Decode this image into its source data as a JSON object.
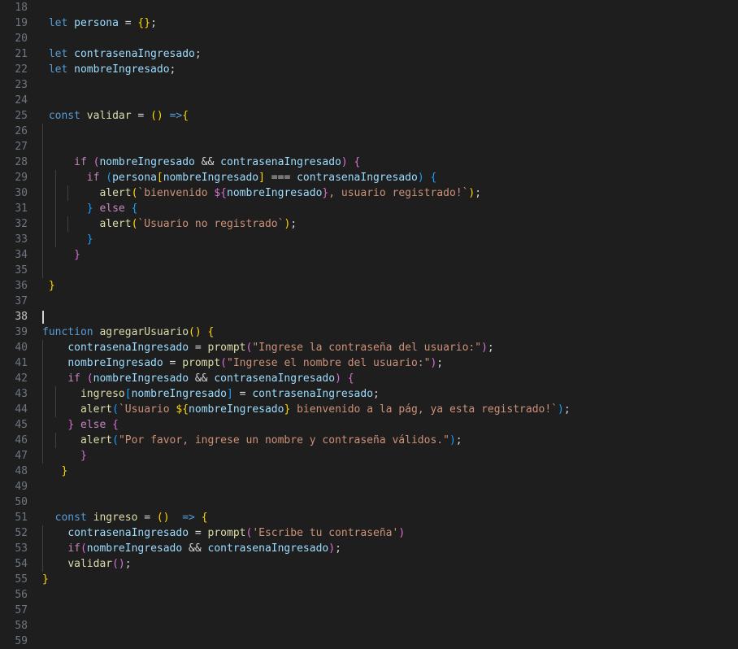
{
  "editor": {
    "language": "javascript",
    "first_line_number": 18,
    "active_line_number": 38,
    "cursor_line": 38,
    "cursor_column": 1,
    "colors": {
      "background": "#1e1e1e",
      "active_line_background": "#222222",
      "line_number": "#6e7681",
      "active_line_number": "#c6c6c6",
      "default_text": "#d4d4d4",
      "keyword": "#569cd6",
      "control_keyword": "#c586c0",
      "variable": "#9cdcfe",
      "function": "#dcdcaa",
      "string": "#ce9178",
      "bracket_level_1": "#ffd700",
      "bracket_level_2": "#da70d6",
      "bracket_level_3": "#179fff",
      "indent_guide": "#404040",
      "cursor": "#d4d4d4"
    },
    "lines": [
      {
        "n": 18,
        "text": ""
      },
      {
        "n": 19,
        "text": "let persona = {};"
      },
      {
        "n": 20,
        "text": ""
      },
      {
        "n": 21,
        "text": "let contrasenaIngresado;"
      },
      {
        "n": 22,
        "text": "let nombreIngresado;"
      },
      {
        "n": 23,
        "text": ""
      },
      {
        "n": 24,
        "text": ""
      },
      {
        "n": 25,
        "text": "const validar = () =>{"
      },
      {
        "n": 26,
        "text": ""
      },
      {
        "n": 27,
        "text": ""
      },
      {
        "n": 28,
        "text": "    if (nombreIngresado && contrasenaIngresado) {"
      },
      {
        "n": 29,
        "text": "      if (persona[nombreIngresado] === contrasenaIngresado) {"
      },
      {
        "n": 30,
        "text": "        alert(`bienvenido ${nombreIngresado}, usuario registrado!`);"
      },
      {
        "n": 31,
        "text": "      } else {"
      },
      {
        "n": 32,
        "text": "        alert(`Usuario no registrado`);"
      },
      {
        "n": 33,
        "text": "      }"
      },
      {
        "n": 34,
        "text": "    }"
      },
      {
        "n": 35,
        "text": ""
      },
      {
        "n": 36,
        "text": " }"
      },
      {
        "n": 37,
        "text": ""
      },
      {
        "n": 38,
        "text": ""
      },
      {
        "n": 39,
        "text": "function agregarUsuario() {"
      },
      {
        "n": 40,
        "text": "    contrasenaIngresado = prompt(\"Ingrese la contraseña del usuario:\");"
      },
      {
        "n": 41,
        "text": "    nombreIngresado = prompt(\"Ingrese el nombre del usuario:\");"
      },
      {
        "n": 42,
        "text": "    if (nombreIngresado && contrasenaIngresado) {"
      },
      {
        "n": 43,
        "text": "      ingreso[nombreIngresado] = contrasenaIngresado;"
      },
      {
        "n": 44,
        "text": "      alert(`Usuario ${nombreIngresado} bienvenido a la pág, ya esta registrado!`);"
      },
      {
        "n": 45,
        "text": "    } else {"
      },
      {
        "n": 46,
        "text": "      alert(\"Por favor, ingrese un nombre y contraseña válidos.\");"
      },
      {
        "n": 47,
        "text": "      }"
      },
      {
        "n": 48,
        "text": "   }"
      },
      {
        "n": 49,
        "text": ""
      },
      {
        "n": 50,
        "text": ""
      },
      {
        "n": 51,
        "text": "  const ingreso = ()  => {"
      },
      {
        "n": 52,
        "text": "    contrasenaIngresado = prompt('Escribe tu contraseña')"
      },
      {
        "n": 53,
        "text": "    if(nombreIngresado && contrasenaIngresado);"
      },
      {
        "n": 54,
        "text": "    validar();"
      },
      {
        "n": 55,
        "text": "}"
      },
      {
        "n": 56,
        "text": ""
      },
      {
        "n": 57,
        "text": ""
      },
      {
        "n": 58,
        "text": ""
      },
      {
        "n": 59,
        "text": ""
      }
    ],
    "tokens": {
      "19": [
        [
          " ",
          "op"
        ],
        [
          "let",
          "kw"
        ],
        [
          " ",
          "op"
        ],
        [
          "persona",
          "var"
        ],
        [
          " = ",
          "op"
        ],
        [
          "{}",
          "by"
        ],
        [
          ";",
          "op"
        ]
      ],
      "21": [
        [
          " ",
          "op"
        ],
        [
          "let",
          "kw"
        ],
        [
          " ",
          "op"
        ],
        [
          "contrasenaIngresado",
          "var"
        ],
        [
          ";",
          "op"
        ]
      ],
      "22": [
        [
          " ",
          "op"
        ],
        [
          "let",
          "kw"
        ],
        [
          " ",
          "op"
        ],
        [
          "nombreIngresado",
          "var"
        ],
        [
          ";",
          "op"
        ]
      ],
      "25": [
        [
          " ",
          "op"
        ],
        [
          "const",
          "kw"
        ],
        [
          " ",
          "op"
        ],
        [
          "validar",
          "fn"
        ],
        [
          " = ",
          "op"
        ],
        [
          "()",
          "by"
        ],
        [
          " ",
          "op"
        ],
        [
          "=>",
          "kw"
        ],
        [
          "{",
          "by"
        ]
      ],
      "28": [
        [
          "     ",
          "op"
        ],
        [
          "if",
          "ctrl"
        ],
        [
          " ",
          "op"
        ],
        [
          "(",
          "bp"
        ],
        [
          "nombreIngresado",
          "var"
        ],
        [
          " && ",
          "op"
        ],
        [
          "contrasenaIngresado",
          "var"
        ],
        [
          ")",
          "bp"
        ],
        [
          " ",
          "op"
        ],
        [
          "{",
          "bp"
        ]
      ],
      "29": [
        [
          "       ",
          "op"
        ],
        [
          "if",
          "ctrl"
        ],
        [
          " ",
          "op"
        ],
        [
          "(",
          "bb"
        ],
        [
          "persona",
          "var"
        ],
        [
          "[",
          "by"
        ],
        [
          "nombreIngresado",
          "var"
        ],
        [
          "]",
          "by"
        ],
        [
          " === ",
          "op"
        ],
        [
          "contrasenaIngresado",
          "var"
        ],
        [
          ")",
          "bb"
        ],
        [
          " ",
          "op"
        ],
        [
          "{",
          "bb"
        ]
      ],
      "30": [
        [
          "         ",
          "op"
        ],
        [
          "alert",
          "fn"
        ],
        [
          "(",
          "by"
        ],
        [
          "`bienvenido ",
          "str"
        ],
        [
          "${",
          "bp"
        ],
        [
          "nombreIngresado",
          "var"
        ],
        [
          "}",
          "bp"
        ],
        [
          ", usuario registrado!`",
          "str"
        ],
        [
          ")",
          "by"
        ],
        [
          ";",
          "op"
        ]
      ],
      "31": [
        [
          "       ",
          "op"
        ],
        [
          "}",
          "bb"
        ],
        [
          " ",
          "op"
        ],
        [
          "else",
          "ctrl"
        ],
        [
          " ",
          "op"
        ],
        [
          "{",
          "bb"
        ]
      ],
      "32": [
        [
          "         ",
          "op"
        ],
        [
          "alert",
          "fn"
        ],
        [
          "(",
          "by"
        ],
        [
          "`Usuario no registrado`",
          "str"
        ],
        [
          ")",
          "by"
        ],
        [
          ";",
          "op"
        ]
      ],
      "33": [
        [
          "       ",
          "op"
        ],
        [
          "}",
          "bb"
        ]
      ],
      "34": [
        [
          "     ",
          "op"
        ],
        [
          "}",
          "bp"
        ]
      ],
      "36": [
        [
          " ",
          "op"
        ],
        [
          "}",
          "by"
        ]
      ],
      "39": [
        [
          "function",
          "kw"
        ],
        [
          " ",
          "op"
        ],
        [
          "agregarUsuario",
          "fn"
        ],
        [
          "()",
          "by"
        ],
        [
          " ",
          "op"
        ],
        [
          "{",
          "by"
        ]
      ],
      "40": [
        [
          "    ",
          "op"
        ],
        [
          "contrasenaIngresado",
          "var"
        ],
        [
          " = ",
          "op"
        ],
        [
          "prompt",
          "fn"
        ],
        [
          "(",
          "bp"
        ],
        [
          "\"Ingrese la contraseña del usuario:\"",
          "str"
        ],
        [
          ")",
          "bp"
        ],
        [
          ";",
          "op"
        ]
      ],
      "41": [
        [
          "    ",
          "op"
        ],
        [
          "nombreIngresado",
          "var"
        ],
        [
          " = ",
          "op"
        ],
        [
          "prompt",
          "fn"
        ],
        [
          "(",
          "bp"
        ],
        [
          "\"Ingrese el nombre del usuario:\"",
          "str"
        ],
        [
          ")",
          "bp"
        ],
        [
          ";",
          "op"
        ]
      ],
      "42": [
        [
          "    ",
          "op"
        ],
        [
          "if",
          "ctrl"
        ],
        [
          " ",
          "op"
        ],
        [
          "(",
          "bp"
        ],
        [
          "nombreIngresado",
          "var"
        ],
        [
          " && ",
          "op"
        ],
        [
          "contrasenaIngresado",
          "var"
        ],
        [
          ")",
          "bp"
        ],
        [
          " ",
          "op"
        ],
        [
          "{",
          "bp"
        ]
      ],
      "43": [
        [
          "      ",
          "op"
        ],
        [
          "ingreso",
          "fn"
        ],
        [
          "[",
          "bb"
        ],
        [
          "nombreIngresado",
          "var"
        ],
        [
          "]",
          "bb"
        ],
        [
          " = ",
          "op"
        ],
        [
          "contrasenaIngresado",
          "var"
        ],
        [
          ";",
          "op"
        ]
      ],
      "44": [
        [
          "      ",
          "op"
        ],
        [
          "alert",
          "fn"
        ],
        [
          "(",
          "bb"
        ],
        [
          "`Usuario ",
          "str"
        ],
        [
          "${",
          "by"
        ],
        [
          "nombreIngresado",
          "var"
        ],
        [
          "}",
          "by"
        ],
        [
          " bienvenido a la pág, ya esta registrado!`",
          "str"
        ],
        [
          ")",
          "bb"
        ],
        [
          ";",
          "op"
        ]
      ],
      "45": [
        [
          "    ",
          "op"
        ],
        [
          "}",
          "bp"
        ],
        [
          " ",
          "op"
        ],
        [
          "else",
          "ctrl"
        ],
        [
          " ",
          "op"
        ],
        [
          "{",
          "bp"
        ]
      ],
      "46": [
        [
          "      ",
          "op"
        ],
        [
          "alert",
          "fn"
        ],
        [
          "(",
          "bb"
        ],
        [
          "\"Por favor, ingrese un nombre y contraseña válidos.\"",
          "str"
        ],
        [
          ")",
          "bb"
        ],
        [
          ";",
          "op"
        ]
      ],
      "47": [
        [
          "      ",
          "op"
        ],
        [
          "}",
          "bp"
        ]
      ],
      "48": [
        [
          "   ",
          "op"
        ],
        [
          "}",
          "by"
        ]
      ],
      "51": [
        [
          "  ",
          "op"
        ],
        [
          "const",
          "kw"
        ],
        [
          " ",
          "op"
        ],
        [
          "ingreso",
          "fn"
        ],
        [
          " = ",
          "op"
        ],
        [
          "()",
          "by"
        ],
        [
          "  ",
          "op"
        ],
        [
          "=>",
          "kw"
        ],
        [
          " ",
          "op"
        ],
        [
          "{",
          "by"
        ]
      ],
      "52": [
        [
          "    ",
          "op"
        ],
        [
          "contrasenaIngresado",
          "var"
        ],
        [
          " = ",
          "op"
        ],
        [
          "prompt",
          "fn"
        ],
        [
          "(",
          "bp"
        ],
        [
          "'Escribe tu contraseña'",
          "str"
        ],
        [
          ")",
          "bp"
        ]
      ],
      "53": [
        [
          "    ",
          "op"
        ],
        [
          "if",
          "ctrl"
        ],
        [
          "(",
          "bp"
        ],
        [
          "nombreIngresado",
          "var"
        ],
        [
          " && ",
          "op"
        ],
        [
          "contrasenaIngresado",
          "var"
        ],
        [
          ")",
          "bp"
        ],
        [
          ";",
          "op"
        ]
      ],
      "54": [
        [
          "    ",
          "op"
        ],
        [
          "validar",
          "fn"
        ],
        [
          "()",
          "bp"
        ],
        [
          ";",
          "op"
        ]
      ],
      "55": [
        [
          "}",
          "by"
        ]
      ]
    },
    "indent_guides": {
      "26": [
        1
      ],
      "27": [
        1
      ],
      "28": [
        1
      ],
      "29": [
        1,
        2
      ],
      "30": [
        1,
        2,
        3
      ],
      "31": [
        1,
        2
      ],
      "32": [
        1,
        2,
        3
      ],
      "33": [
        1,
        2
      ],
      "34": [
        1
      ],
      "35": [
        1
      ],
      "40": [
        1
      ],
      "41": [
        1
      ],
      "42": [
        1
      ],
      "43": [
        1,
        2
      ],
      "44": [
        1,
        2
      ],
      "45": [
        1
      ],
      "46": [
        1,
        2
      ],
      "47": [
        1
      ],
      "52": [
        1
      ],
      "53": [
        1
      ],
      "54": [
        1
      ]
    }
  }
}
